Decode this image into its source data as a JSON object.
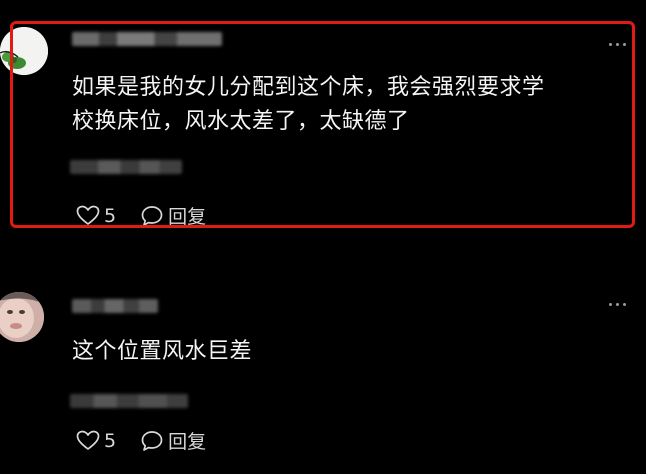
{
  "colors": {
    "background": "#000000",
    "text": "#f4f4f4",
    "muted": "#9a9a9a",
    "highlight_border": "#e11a14"
  },
  "comments": [
    {
      "username": "",
      "text_line1": "如果是我的女儿分配到这个床，我会强烈要求学",
      "text_line2": "校换床位，风水太差了，太缺德了",
      "meta": "",
      "likes": "5",
      "reply_label": "回复",
      "highlighted": true
    },
    {
      "username": "",
      "text_line1": "这个位置风水巨差",
      "meta": "",
      "likes": "5",
      "reply_label": "回复",
      "highlighted": false
    }
  ],
  "icons": {
    "like": "heart-outline-icon",
    "reply": "speech-bubble-icon",
    "more": "more-dots-icon"
  }
}
